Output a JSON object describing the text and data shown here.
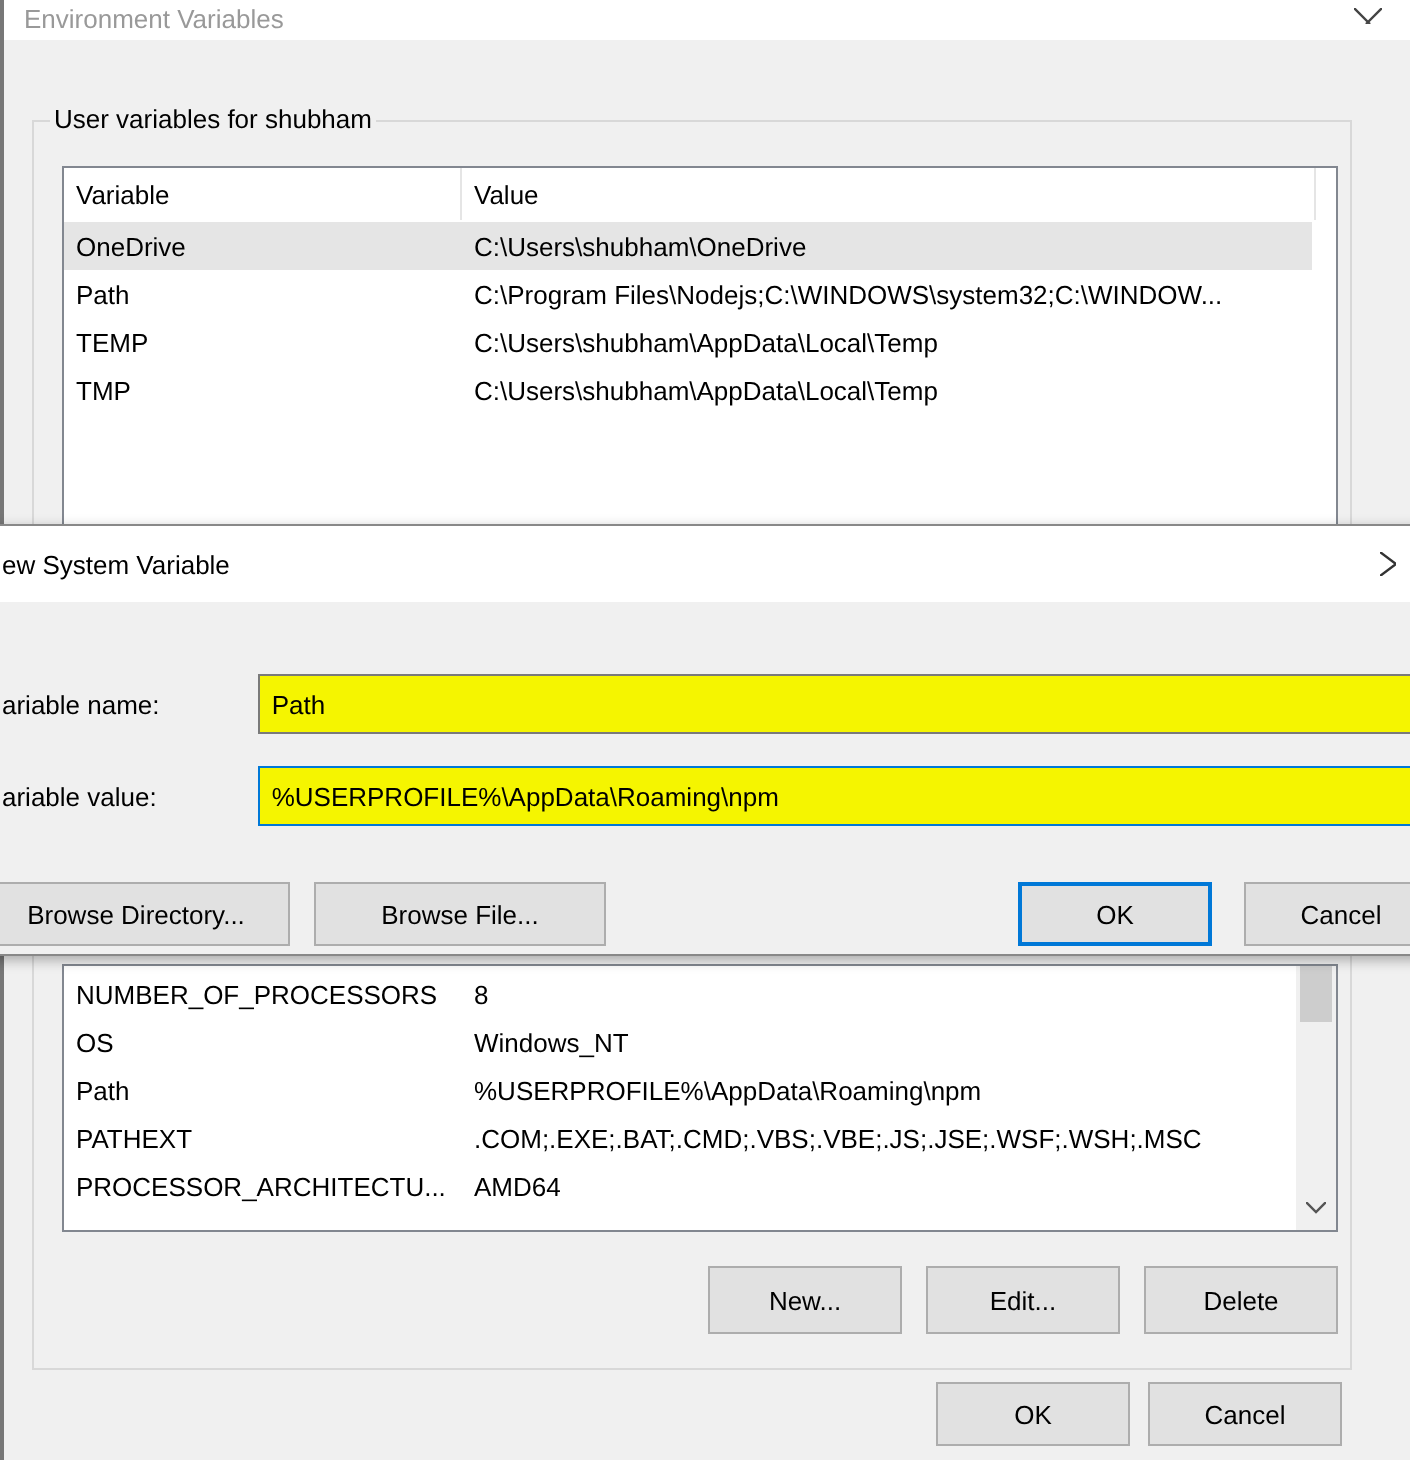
{
  "window": {
    "title": "Environment Variables"
  },
  "user_variables": {
    "title": "User variables for shubham",
    "columns": [
      "Variable",
      "Value"
    ],
    "rows": [
      {
        "variable": "OneDrive",
        "value": "C:\\Users\\shubham\\OneDrive",
        "selected": true
      },
      {
        "variable": "Path",
        "value": "C:\\Program Files\\Nodejs;C:\\WINDOWS\\system32;C:\\WINDOW...",
        "selected": false
      },
      {
        "variable": "TEMP",
        "value": "C:\\Users\\shubham\\AppData\\Local\\Temp",
        "selected": false
      },
      {
        "variable": "TMP",
        "value": "C:\\Users\\shubham\\AppData\\Local\\Temp",
        "selected": false
      }
    ]
  },
  "system_variables": {
    "rows": [
      {
        "variable": "NUMBER_OF_PROCESSORS",
        "value": "8"
      },
      {
        "variable": "OS",
        "value": "Windows_NT"
      },
      {
        "variable": "Path",
        "value": "%USERPROFILE%\\AppData\\Roaming\\npm"
      },
      {
        "variable": "PATHEXT",
        "value": ".COM;.EXE;.BAT;.CMD;.VBS;.VBE;.JS;.JSE;.WSF;.WSH;.MSC"
      },
      {
        "variable": "PROCESSOR_ARCHITECTU...",
        "value": "AMD64"
      }
    ],
    "buttons": [
      "New...",
      "Edit...",
      "Delete"
    ]
  },
  "buttons": [
    "OK",
    "Cancel"
  ],
  "dialog": {
    "title": "ew System Variable",
    "fields": [
      {
        "label": "ariable name:",
        "value": "Path",
        "focused": false
      },
      {
        "label": "ariable value:",
        "value": "%USERPROFILE%\\AppData\\Roaming\\npm",
        "focused": true
      }
    ],
    "browse_buttons": [
      "Browse Directory...",
      "Browse File..."
    ],
    "buttons": [
      {
        "label": "OK",
        "default": true
      },
      {
        "label": "Cancel",
        "default": false
      }
    ]
  }
}
